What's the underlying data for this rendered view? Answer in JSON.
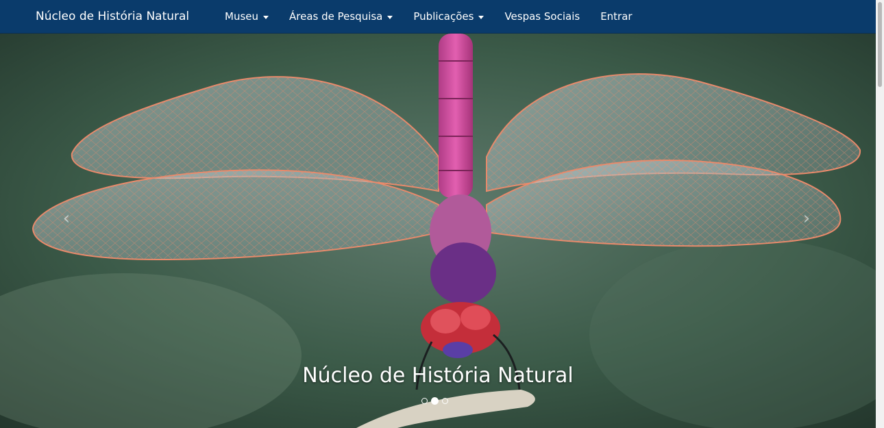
{
  "navbar": {
    "brand": "Núcleo de História Natural",
    "items": [
      {
        "label": "Museu",
        "dropdown": true
      },
      {
        "label": "Áreas de Pesquisa",
        "dropdown": true
      },
      {
        "label": "Publicações",
        "dropdown": true
      },
      {
        "label": "Vespas Sociais",
        "dropdown": false
      },
      {
        "label": "Entrar",
        "dropdown": false
      }
    ],
    "background_color": "#0a3b6b"
  },
  "carousel": {
    "caption": "Núcleo de História Natural",
    "prev_icon": "chevron-left-icon",
    "next_icon": "chevron-right-icon",
    "prev_glyph": "‹",
    "next_glyph": "›",
    "slide_count": 3,
    "active_index": 1,
    "image_subject": "dragonfly photograph"
  }
}
